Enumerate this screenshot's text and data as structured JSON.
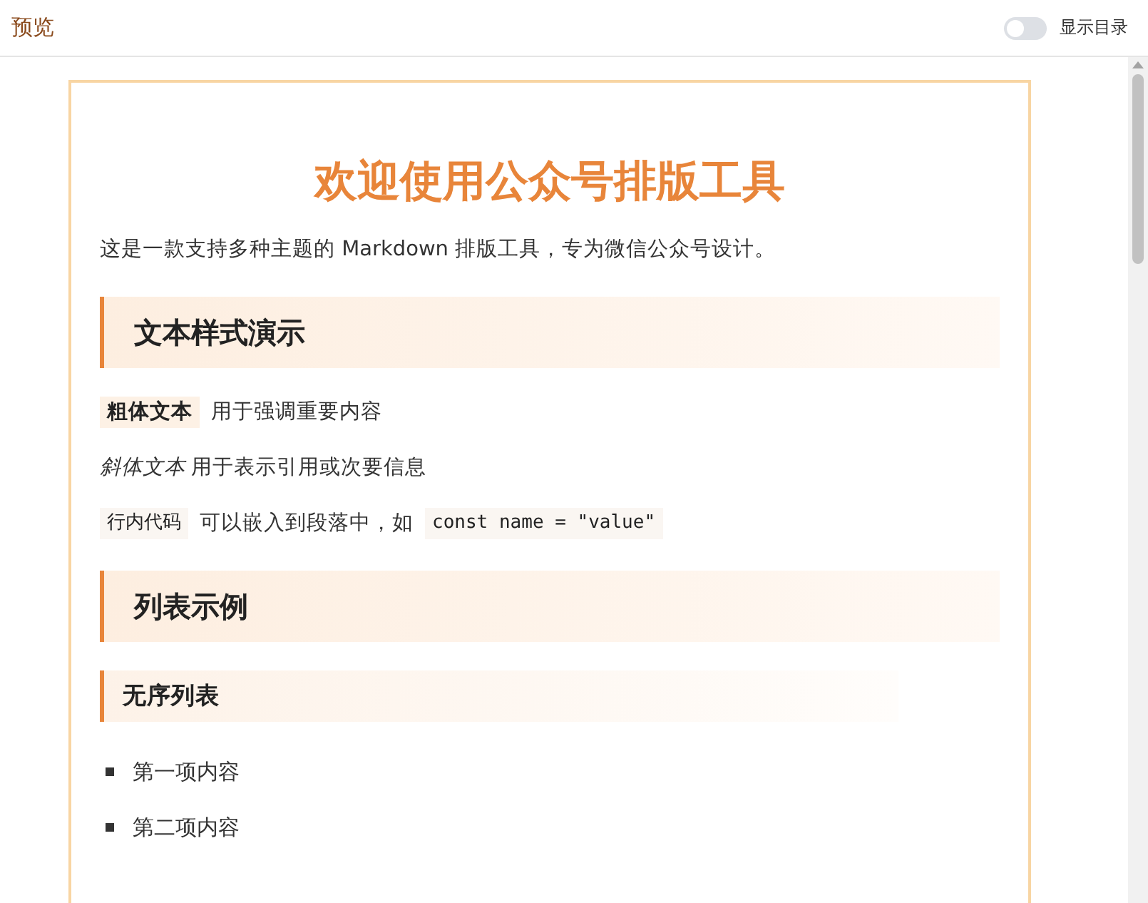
{
  "header": {
    "title": "预览",
    "toggle": {
      "label": "显示目录",
      "on": false
    }
  },
  "article": {
    "title": "欢迎使用公众号排版工具",
    "blocks": [
      {
        "kind": "p",
        "runs": [
          {
            "kind": "text",
            "text": "这是一款支持多种主题的 Markdown 排版工具，专为微信公众号设计。"
          }
        ]
      },
      {
        "kind": "h2",
        "text": "文本样式演示"
      },
      {
        "kind": "p",
        "runs": [
          {
            "kind": "strong",
            "text": "粗体文本"
          },
          {
            "kind": "text",
            "text": "用于强调重要内容"
          }
        ]
      },
      {
        "kind": "p",
        "runs": [
          {
            "kind": "em",
            "text": "斜体文本"
          },
          {
            "kind": "text",
            "text": "用于表示引用或次要信息"
          }
        ]
      },
      {
        "kind": "p",
        "runs": [
          {
            "kind": "code",
            "text": "行内代码"
          },
          {
            "kind": "text",
            "text": "可以嵌入到段落中，如"
          },
          {
            "kind": "code",
            "text": "const name = \"value\""
          }
        ]
      },
      {
        "kind": "h2",
        "text": "列表示例"
      },
      {
        "kind": "h3",
        "text": "无序列表"
      },
      {
        "kind": "ul",
        "items": [
          "第一项内容",
          "第二项内容"
        ]
      }
    ]
  }
}
